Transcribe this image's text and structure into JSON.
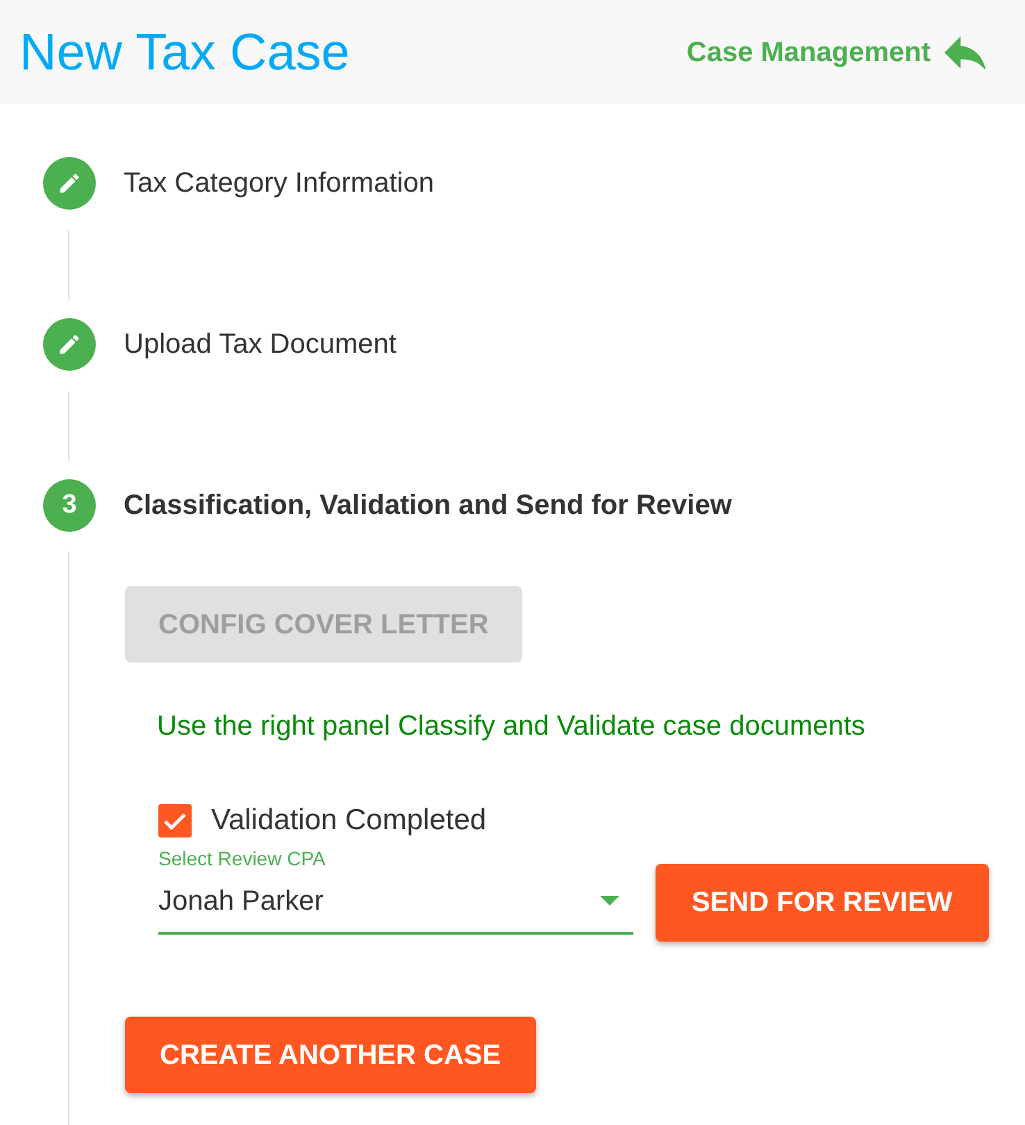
{
  "header": {
    "title": "New Tax Case",
    "back_link": {
      "label": "Case Management"
    }
  },
  "steps": [
    {
      "kind": "edit",
      "label": "Tax Category Information",
      "active": false
    },
    {
      "kind": "edit",
      "label": "Upload Tax Document",
      "active": false
    },
    {
      "kind": "number",
      "number": "3",
      "label": "Classification, Validation and Send for Review",
      "active": true,
      "content": {
        "config_button": {
          "label": "CONFIG COVER LETTER",
          "disabled": true
        },
        "instruction": "Use the right panel Classify and Validate case documents",
        "validation_checkbox": {
          "label": "Validation Completed",
          "checked": true
        },
        "review_select": {
          "label": "Select Review CPA",
          "value": "Jonah Parker"
        },
        "send_button": {
          "label": "SEND FOR REVIEW"
        },
        "create_button": {
          "label": "CREATE ANOTHER CASE"
        }
      }
    }
  ]
}
